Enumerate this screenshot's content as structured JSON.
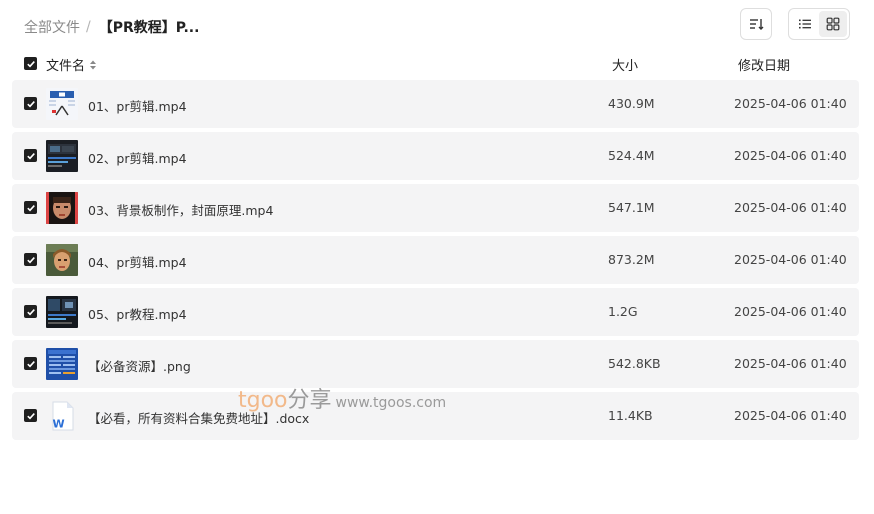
{
  "breadcrumb": {
    "root": "全部文件",
    "separator": "/",
    "current": "【PR教程】P..."
  },
  "toolbar": {
    "sort_icon": "sort-icon",
    "list_view_icon": "list-view-icon",
    "grid_view_icon": "grid-view-icon",
    "active_view": "list"
  },
  "table": {
    "headers": {
      "name": "文件名",
      "size": "大小",
      "date": "修改日期"
    },
    "rows": [
      {
        "name": "01、pr剪辑.mp4",
        "size": "430.9M",
        "date": "2025-04-06 01:40",
        "thumb": "video-thumbnail-1",
        "checked": true
      },
      {
        "name": "02、pr剪辑.mp4",
        "size": "524.4M",
        "date": "2025-04-06 01:40",
        "thumb": "video-thumbnail-2",
        "checked": true
      },
      {
        "name": "03、背景板制作，封面原理.mp4",
        "size": "547.1M",
        "date": "2025-04-06 01:40",
        "thumb": "video-thumbnail-3",
        "checked": true
      },
      {
        "name": "04、pr剪辑.mp4",
        "size": "873.2M",
        "date": "2025-04-06 01:40",
        "thumb": "video-thumbnail-4",
        "checked": true
      },
      {
        "name": "05、pr教程.mp4",
        "size": "1.2G",
        "date": "2025-04-06 01:40",
        "thumb": "video-thumbnail-5",
        "checked": true
      },
      {
        "name": "【必备资源】.png",
        "size": "542.8KB",
        "date": "2025-04-06 01:40",
        "thumb": "image-thumbnail",
        "checked": true
      },
      {
        "name": "【必看，所有资料合集免费地址】.docx",
        "size": "11.4KB",
        "date": "2025-04-06 01:40",
        "thumb": "word-doc-icon",
        "checked": true
      }
    ]
  },
  "watermark": {
    "brand": "tgoo",
    "cn": "分享",
    "url": "www.tgoos.com"
  },
  "colors": {
    "row_bg": "#f4f4f5",
    "checkbox": "#1f1f1f",
    "watermark_brand": "#f2b98a",
    "word_blue": "#2b6fd6"
  }
}
